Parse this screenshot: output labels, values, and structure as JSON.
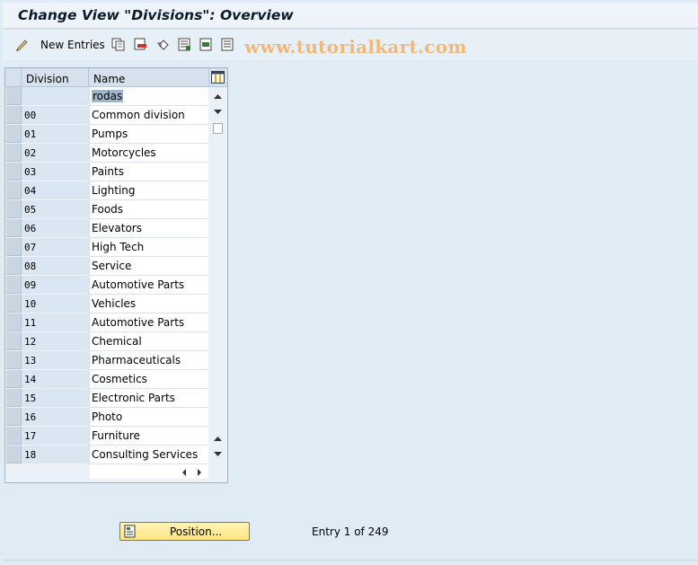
{
  "title": "Change View \"Divisions\": Overview",
  "toolbar": {
    "new_entries_label": "New Entries",
    "icons": [
      "edit-glasses-icon",
      "copy-icon",
      "delete-icon",
      "undo-icon",
      "select-all-icon",
      "select-block-icon",
      "deselect-all-icon"
    ]
  },
  "watermark": "www.tutorialkart.com",
  "table": {
    "headers": {
      "division": "Division",
      "name": "Name"
    },
    "rows": [
      {
        "division": "",
        "name": "rodas"
      },
      {
        "division": "00",
        "name": "Common division"
      },
      {
        "division": "01",
        "name": "Pumps"
      },
      {
        "division": "02",
        "name": "Motorcycles"
      },
      {
        "division": "03",
        "name": "Paints"
      },
      {
        "division": "04",
        "name": "Lighting"
      },
      {
        "division": "05",
        "name": "Foods"
      },
      {
        "division": "06",
        "name": "Elevators"
      },
      {
        "division": "07",
        "name": "High Tech"
      },
      {
        "division": "08",
        "name": "Service"
      },
      {
        "division": "09",
        "name": "Automotive Parts"
      },
      {
        "division": "10",
        "name": "Vehicles"
      },
      {
        "division": "11",
        "name": "Automotive Parts"
      },
      {
        "division": "12",
        "name": "Chemical"
      },
      {
        "division": "13",
        "name": "Pharmaceuticals"
      },
      {
        "division": "14",
        "name": "Cosmetics"
      },
      {
        "division": "15",
        "name": "Electronic Parts"
      },
      {
        "division": "16",
        "name": "Photo"
      },
      {
        "division": "17",
        "name": "Furniture"
      },
      {
        "division": "18",
        "name": "Consulting Services"
      }
    ]
  },
  "position_button_label": "Position...",
  "entry_status": "Entry 1 of 249",
  "colors": {
    "accent": "#ffe680",
    "selection": "#9fb6cd"
  }
}
